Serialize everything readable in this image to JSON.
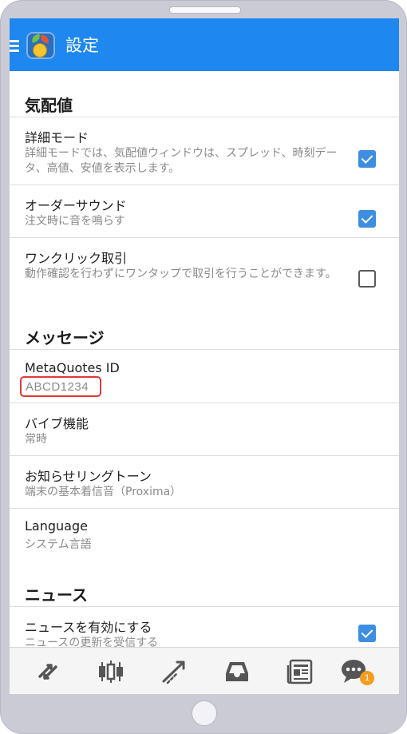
{
  "app": {
    "title": "設定"
  },
  "sections": {
    "quotes": {
      "header": "気配値",
      "advanced": {
        "title": "詳細モード",
        "subtitle": "詳細モードでは、気配値ウィンドウは、スプレッド、時刻データ、高値、安値を表示します。",
        "checked": true
      },
      "order_sound": {
        "title": "オーダーサウンド",
        "subtitle": "注文時に音を鳴らす",
        "checked": true
      },
      "one_click": {
        "title": "ワンクリック取引",
        "subtitle": "動作確認を行わずにワンタップで取引を行うことができます。",
        "checked": false
      }
    },
    "messages": {
      "header": "メッセージ",
      "metaquotes_id": {
        "title": "MetaQuotes ID",
        "value": "ABCD1234"
      },
      "vibration": {
        "title": "バイブ機能",
        "value": "常時"
      },
      "ringtone": {
        "title": "お知らせリングトーン",
        "value": "端末の基本着信音（Proxima）"
      },
      "language": {
        "title": "Language",
        "value": "システム言語"
      }
    },
    "news": {
      "header": "ニュース",
      "enable": {
        "title": "ニュースを有効にする",
        "subtitle": "ニュースの更新を受信する",
        "checked": true
      }
    }
  },
  "bottom_nav": {
    "items": [
      "quotes-icon",
      "chart-icon",
      "trade-icon",
      "history-icon",
      "news-icon",
      "chat-icon"
    ],
    "chat_badge": "1"
  },
  "colors": {
    "accent": "#1e88f0",
    "checkbox": "#3d8ee2",
    "highlight": "#e53935",
    "badge": "#f39c1e"
  }
}
